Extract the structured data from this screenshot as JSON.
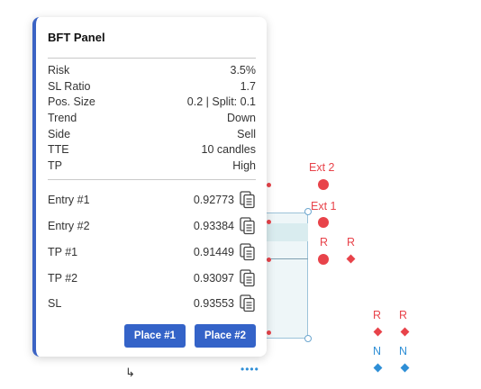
{
  "panel": {
    "title": "BFT Panel",
    "info": [
      {
        "label": "Risk",
        "value": "3.5%"
      },
      {
        "label": "SL Ratio",
        "value": "1.7"
      },
      {
        "label": "Pos. Size",
        "value": "0.2 | Split: 0.1"
      },
      {
        "label": "Trend",
        "value": "Down"
      },
      {
        "label": "Side",
        "value": "Sell"
      },
      {
        "label": "TTE",
        "value": "10 candles"
      },
      {
        "label": "TP",
        "value": "High"
      }
    ],
    "prices": [
      {
        "label": "Entry #1",
        "value": "0.92773"
      },
      {
        "label": "Entry #2",
        "value": "0.93384"
      },
      {
        "label": "TP #1",
        "value": "0.91449"
      },
      {
        "label": "TP #2",
        "value": "0.93097"
      },
      {
        "label": "SL",
        "value": "0.93553"
      }
    ],
    "buttons": {
      "place1": "Place #1",
      "place2": "Place #2"
    },
    "icons": {
      "copy": "copy-icon"
    },
    "accent_color": "#3463c8"
  },
  "chart": {
    "labels": {
      "ext2": "Ext 2",
      "ext1": "Ext 1",
      "r": "R",
      "n": "N"
    },
    "colors": {
      "red": "#e8434a",
      "blue": "#2f8fd6",
      "zone": "#eef6f8"
    },
    "more_dots": "••••"
  }
}
